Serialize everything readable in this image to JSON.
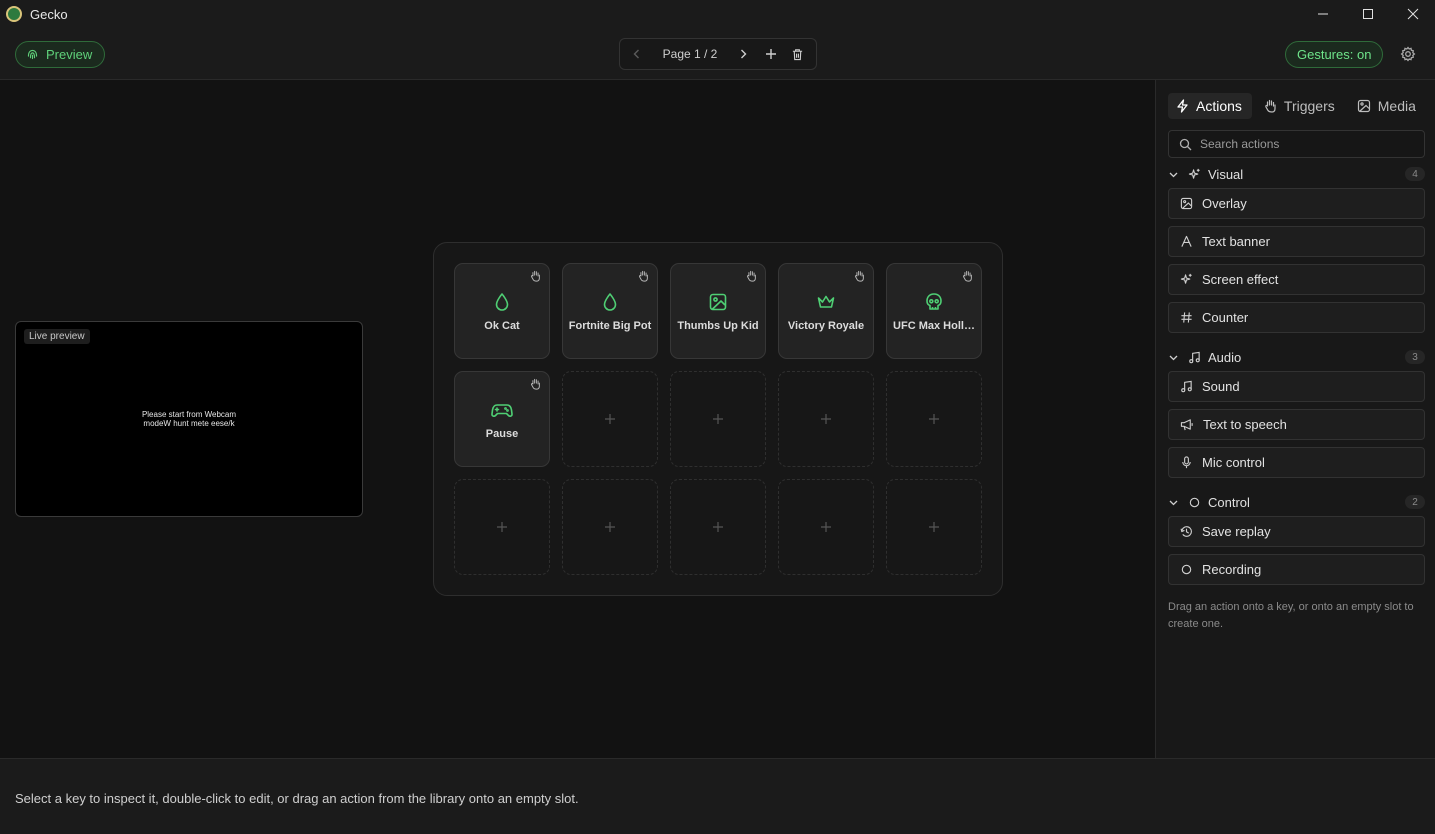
{
  "window": {
    "title": "Gecko"
  },
  "toolbar": {
    "preview_label": "Preview",
    "page_label": "Page 1 / 2",
    "gestures_label": "Gestures: on"
  },
  "live_preview": {
    "badge": "Live preview",
    "message_line1": "Please start from Webcam",
    "message_line2": "modeW hunt mete eese/k"
  },
  "deck": {
    "keys": [
      {
        "label": "Ok Cat",
        "icon": "drop-icon"
      },
      {
        "label": "Fortnite Big Pot",
        "icon": "drop-icon"
      },
      {
        "label": "Thumbs Up Kid",
        "icon": "image-icon"
      },
      {
        "label": "Victory Royale",
        "icon": "crown-icon"
      },
      {
        "label": "UFC Max Holl…",
        "icon": "skull-icon"
      },
      {
        "label": "Pause",
        "icon": "gamepad-icon"
      }
    ]
  },
  "sidebar": {
    "tabs": [
      {
        "label": "Actions",
        "active": true
      },
      {
        "label": "Triggers",
        "active": false
      },
      {
        "label": "Media",
        "active": false
      }
    ],
    "search_placeholder": "Search actions",
    "sections": [
      {
        "title": "Visual",
        "count": "4",
        "items": [
          "Overlay",
          "Text banner",
          "Screen effect",
          "Counter"
        ]
      },
      {
        "title": "Audio",
        "count": "3",
        "items": [
          "Sound",
          "Text to speech",
          "Mic control"
        ]
      },
      {
        "title": "Control",
        "count": "2",
        "items": [
          "Save replay",
          "Recording"
        ]
      }
    ],
    "hint": "Drag an action onto a key, or onto an empty slot to create one."
  },
  "status": {
    "text": "Select a key to inspect it, double-click to edit, or drag an action from the library onto an empty slot."
  },
  "colors": {
    "accent": "#4fcf74",
    "background": "#121212",
    "panel": "#181818"
  }
}
